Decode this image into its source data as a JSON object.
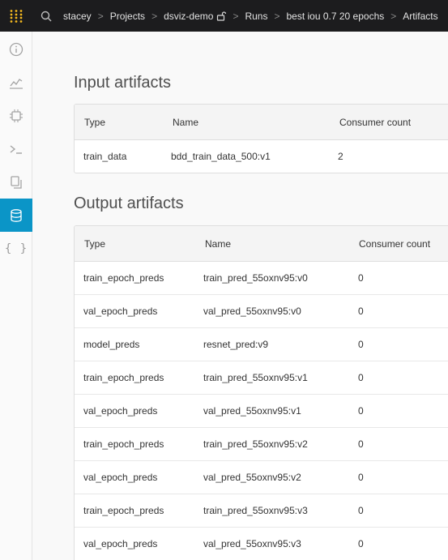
{
  "breadcrumb": {
    "items": [
      "stacey",
      "Projects",
      "dsviz-demo",
      "Runs",
      "best iou 0.7 20 epochs",
      "Artifacts"
    ],
    "separator": ">"
  },
  "icons": {
    "logo": "wandb-logo-icon",
    "search": "search-icon",
    "lock": "unlock-icon",
    "sidebar": [
      "info-icon",
      "chart-icon",
      "chip-icon",
      "terminal-icon",
      "files-icon",
      "database-icon",
      "braces-icon"
    ]
  },
  "sidebar": {
    "braces_glyph": "{ }",
    "active_index": 5
  },
  "input_artifacts": {
    "title": "Input artifacts",
    "columns": [
      "Type",
      "Name",
      "Consumer count"
    ],
    "rows": [
      [
        "train_data",
        "bdd_train_data_500:v1",
        "2"
      ]
    ]
  },
  "output_artifacts": {
    "title": "Output artifacts",
    "columns": [
      "Type",
      "Name",
      "Consumer count"
    ],
    "rows": [
      [
        "train_epoch_preds",
        "train_pred_55oxnv95:v0",
        "0"
      ],
      [
        "val_epoch_preds",
        "val_pred_55oxnv95:v0",
        "0"
      ],
      [
        "model_preds",
        "resnet_pred:v9",
        "0"
      ],
      [
        "train_epoch_preds",
        "train_pred_55oxnv95:v1",
        "0"
      ],
      [
        "val_epoch_preds",
        "val_pred_55oxnv95:v1",
        "0"
      ],
      [
        "train_epoch_preds",
        "train_pred_55oxnv95:v2",
        "0"
      ],
      [
        "val_epoch_preds",
        "val_pred_55oxnv95:v2",
        "0"
      ],
      [
        "train_epoch_preds",
        "train_pred_55oxnv95:v3",
        "0"
      ],
      [
        "val_epoch_preds",
        "val_pred_55oxnv95:v3",
        "0"
      ]
    ]
  },
  "colors": {
    "topbar": "#1c1c1e",
    "accent": "#0b95c7",
    "logo": "#f5b91e"
  }
}
